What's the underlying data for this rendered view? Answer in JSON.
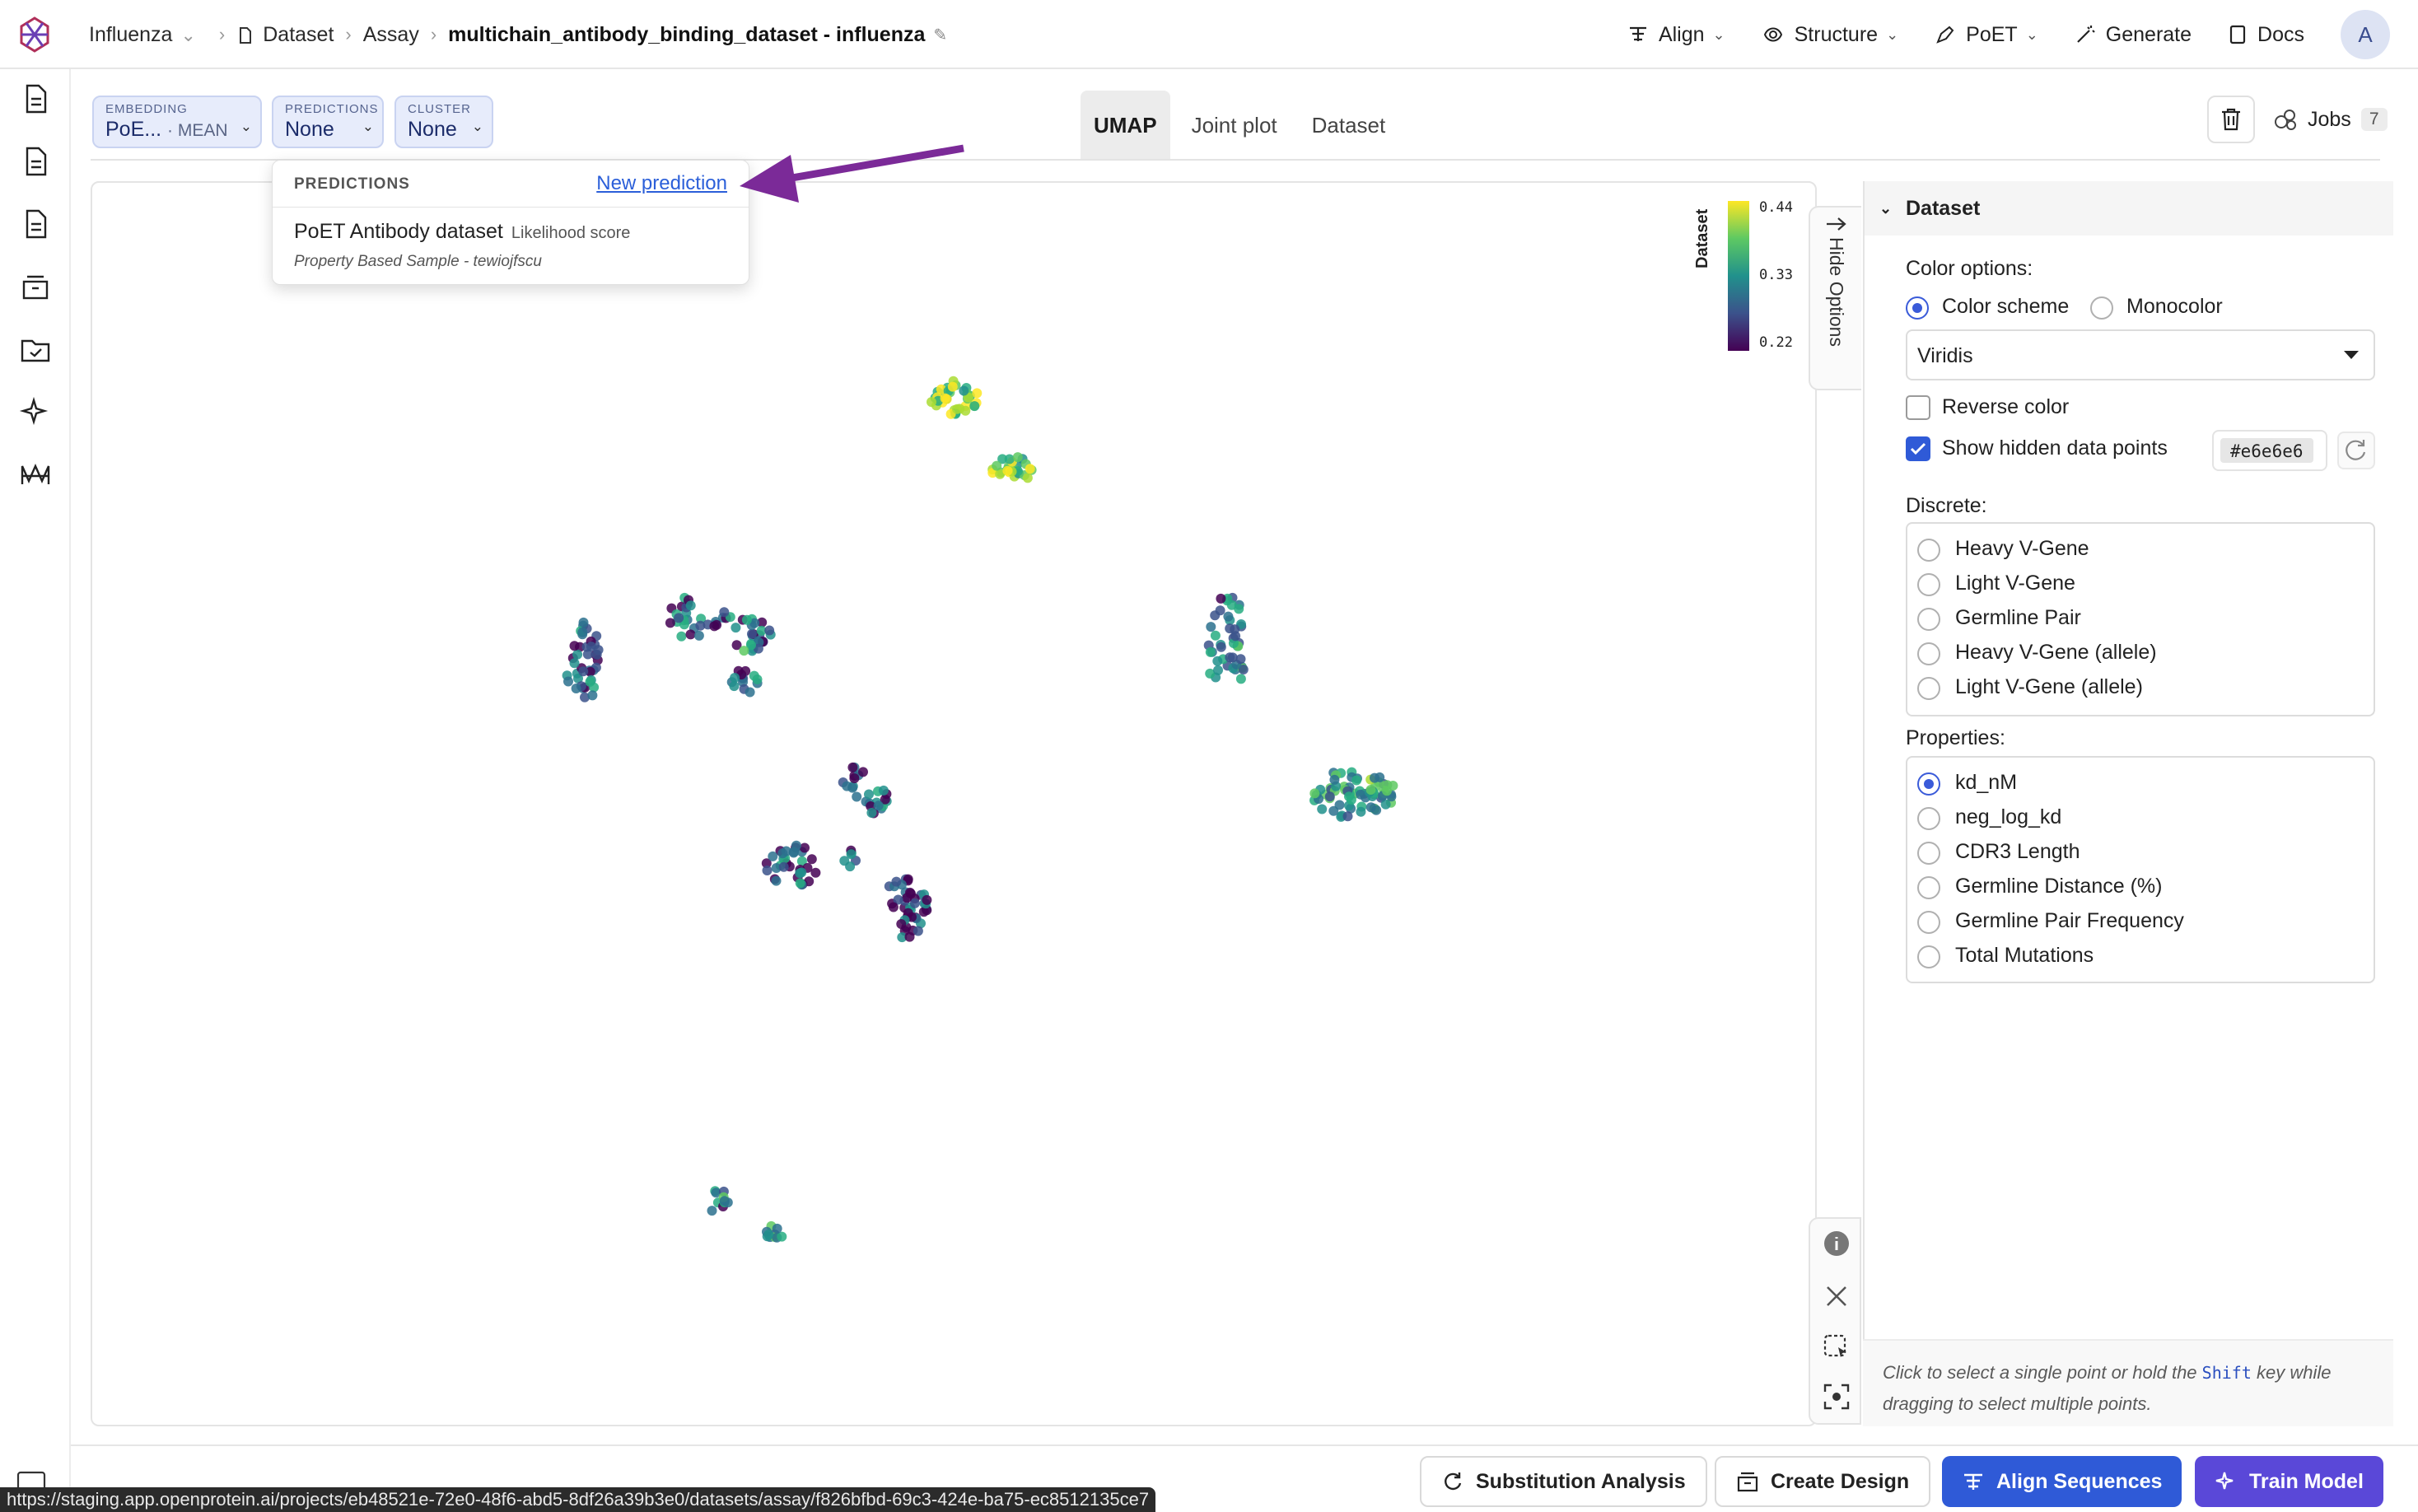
{
  "header": {
    "project": "Influenza",
    "crumb_dataset": "Dataset",
    "crumb_assay": "Assay",
    "title": "multichain_antibody_binding_dataset - influenza",
    "nav": {
      "align": "Align",
      "structure": "Structure",
      "poet": "PoET",
      "generate": "Generate",
      "docs": "Docs"
    },
    "avatar": "A"
  },
  "toolbar": {
    "embedding_label": "EMBEDDING",
    "embedding_value": "PoE...",
    "embedding_sub": "· MEAN",
    "predictions_label": "PREDICTIONS",
    "predictions_value": "None",
    "cluster_label": "CLUSTER",
    "cluster_value": "None",
    "tabs": [
      "UMAP",
      "Joint plot",
      "Dataset"
    ],
    "active_tab": "UMAP",
    "jobs_label": "Jobs",
    "jobs_count": "7"
  },
  "dropdown": {
    "header": "PREDICTIONS",
    "new_link": "New prediction",
    "item_name": "PoET Antibody dataset",
    "item_kind": "Likelihood score",
    "item_meta": "Property Based Sample - tewiojfscu"
  },
  "plot": {
    "colorbar_title": "Dataset",
    "colorbar_ticks": [
      "0.44",
      "0.33",
      "0.22"
    ],
    "hide_options": "Hide Options"
  },
  "panel": {
    "title": "Dataset",
    "color_options": "Color options:",
    "color_scheme": "Color scheme",
    "monocolor": "Monocolor",
    "palette": "Viridis",
    "reverse_color": "Reverse color",
    "show_hidden": "Show hidden data points",
    "hidden_color": "#e6e6e6",
    "discrete_label": "Discrete:",
    "discrete": [
      "Heavy V-Gene",
      "Light V-Gene",
      "Germline Pair",
      "Heavy V-Gene (allele)",
      "Light V-Gene (allele)"
    ],
    "properties_label": "Properties:",
    "properties": [
      "kd_nM",
      "neg_log_kd",
      "CDR3 Length",
      "Germline Distance (%)",
      "Germline Pair Frequency",
      "Total Mutations"
    ],
    "selected_property": "kd_nM",
    "hint_pre": "Click to select a single point or hold the",
    "hint_key": "Shift",
    "hint_post": "key while dragging to select multiple points."
  },
  "bottom": {
    "substitution": "Substitution Analysis",
    "create_design": "Create Design",
    "align_sequences": "Align Sequences",
    "train_model": "Train Model"
  },
  "status_url": "https://staging.app.openprotein.ai/projects/eb48521e-72e0-48f6-abd5-8df26a39b3e0/datasets/assay/f826bfbd-69c3-424e-ba75-ec8512135ce7",
  "colors": {
    "accent": "#2f5ad7",
    "purple": "#5a48d8",
    "arrow": "#7b2a98"
  }
}
